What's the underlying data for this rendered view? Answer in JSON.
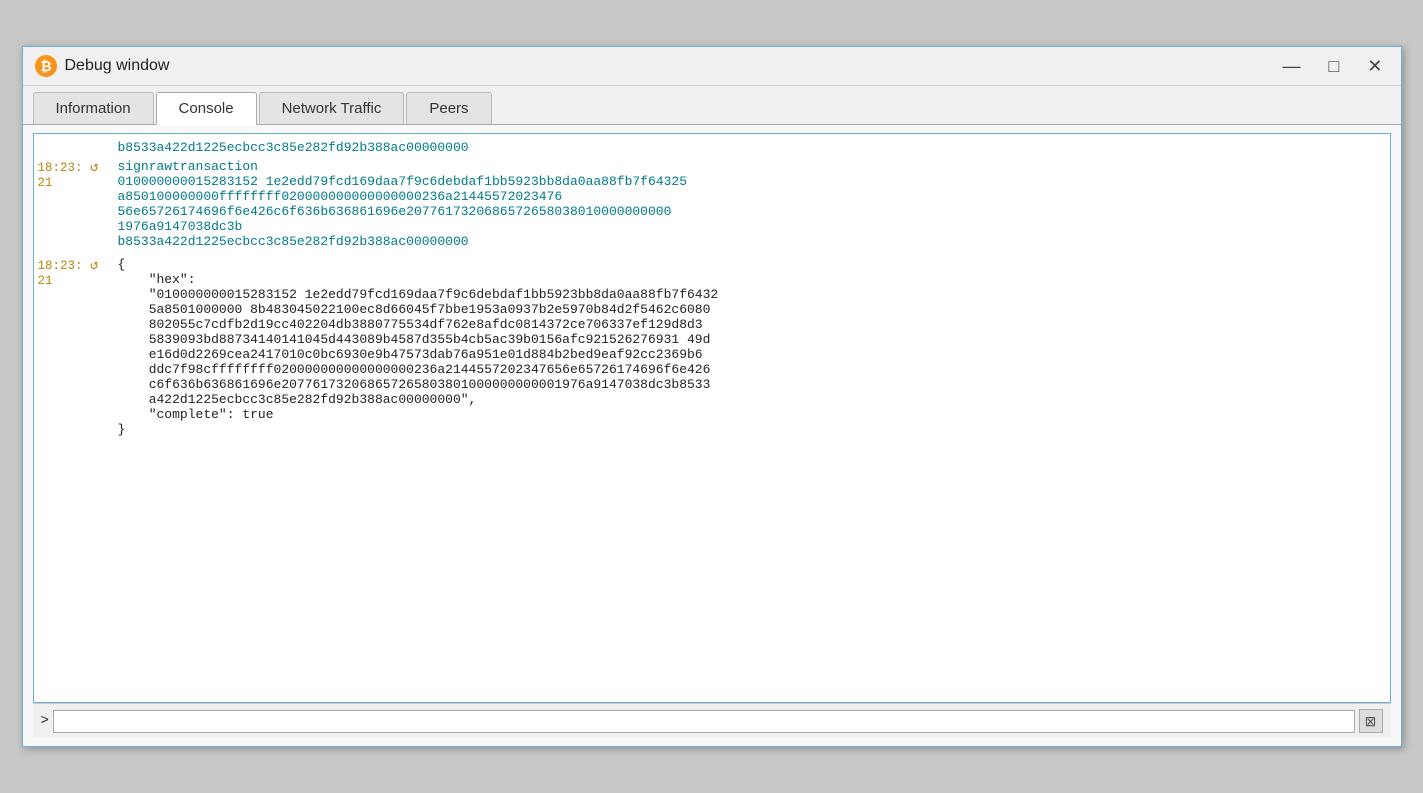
{
  "window": {
    "title": "Debug window",
    "icon": "bitcoin-logo"
  },
  "titlebar": {
    "minimize": "—",
    "maximize": "□",
    "close": "✕"
  },
  "tabs": [
    {
      "label": "Information",
      "active": false
    },
    {
      "label": "Console",
      "active": true
    },
    {
      "label": "Network Traffic",
      "active": false
    },
    {
      "label": "Peers",
      "active": false
    }
  ],
  "console": {
    "lines": [
      {
        "type": "plain_teal",
        "indent": false,
        "text": "b8533a422d1225ecbcc3c85e282fd92b388ac00000000"
      },
      {
        "type": "cmd_teal",
        "timestamp": "18:23:",
        "linenum": "21",
        "arrow": "↺",
        "text": "signrawtransaction"
      },
      {
        "type": "long_teal",
        "linenum": "",
        "text": "010000000015283152 1e2edd79fcd169daa7f9c6debdaf1bb5923bb8da0aa88fb7f64325a850100000000ffffffff020000000000000000236a214455720234765 6e65726174696f6e426c6f636b636861696e20776173206865726580380100000000001976a9147038dc3b8533a422d1225ecbcc3c85e282fd92b388ac00000000"
      },
      {
        "type": "cmd_black",
        "timestamp": "18:23:",
        "linenum": "21",
        "arrow": "↺",
        "text": "{"
      },
      {
        "type": "json_black",
        "text": "    \"hex\":"
      },
      {
        "type": "json_black",
        "text": "    \"010000000015283152 1e2edd79fcd169daa7f9c6debdaf1bb5923bb8da0aa88fb7f64325a8501000000 8b483045022100ec8d66045f7bbe1953a0937b2e5970b84d2f5462c6080802055c7cdfb2d19cc402204db3880775534df762e8afdc0814372ce706337ef129d8d35839093bd88734140141045d443089b4587d355b4cb5ac39b0156afc921526276931 49de16d0d2269cea2417010c0bc6930e9b47573dab76a951e01d884b2bed9eaf92cc2369b6ddc7f98cffffffff020000000000000000236a214455720234765 6e65726174696f6e426c6f636b636861696e20776173206865726580380100000000001976a9147038dc3b8533a422d1225ecbcc3c85e282fd92b388ac00000000\","
      },
      {
        "type": "json_black",
        "text": "    \"complete\": true"
      },
      {
        "type": "json_black",
        "text": "}"
      }
    ],
    "input_placeholder": "",
    "prompt": ">",
    "clear_btn": "⊠"
  }
}
